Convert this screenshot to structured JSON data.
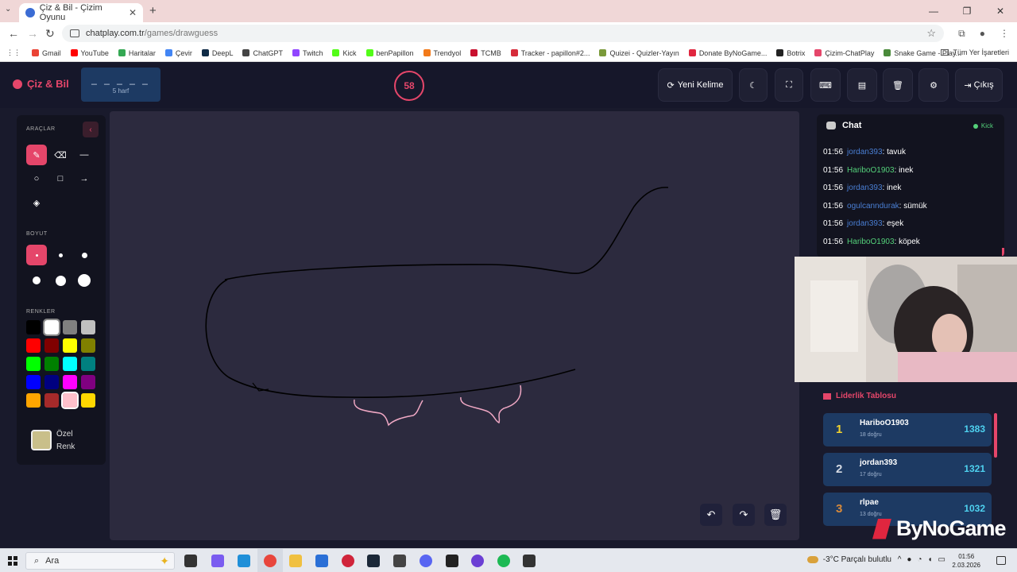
{
  "browser": {
    "tab_title": "Çiz & Bil - Çizim Oyunu",
    "url_domain": "chatplay.com.tr",
    "url_path": "/games/drawguess",
    "bookmarks": [
      {
        "label": "Gmail",
        "color": "#ea4335"
      },
      {
        "label": "YouTube",
        "color": "#ff0000"
      },
      {
        "label": "Haritalar",
        "color": "#34a853"
      },
      {
        "label": "Çevir",
        "color": "#4285f4"
      },
      {
        "label": "DeepL",
        "color": "#0f2b46"
      },
      {
        "label": "ChatGPT",
        "color": "#444444"
      },
      {
        "label": "Twitch",
        "color": "#9146ff"
      },
      {
        "label": "Kick",
        "color": "#53fc18"
      },
      {
        "label": "benPapillon",
        "color": "#53fc18"
      },
      {
        "label": "Trendyol",
        "color": "#f27a1a"
      },
      {
        "label": "TCMB",
        "color": "#c8102e"
      },
      {
        "label": "Tracker - papillon#2...",
        "color": "#d62b3a"
      },
      {
        "label": "Quizei - Quizler-Yayın",
        "color": "#7a9a3a"
      },
      {
        "label": "Donate ByNoGame...",
        "color": "#e0263f"
      },
      {
        "label": "Botrix",
        "color": "#222222"
      },
      {
        "label": "Çizim-ChatPlay",
        "color": "#e5466a"
      },
      {
        "label": "Snake Game - Play...",
        "color": "#4a8a3a"
      }
    ],
    "all_bookmarks": "Tüm Yer İşaretleri"
  },
  "app": {
    "logo": "Çiz & Bil",
    "word_blanks": "_ _ _ _ _",
    "word_hint": "5 harf",
    "timer": "58",
    "new_word": "Yeni Kelime",
    "exit": "Çıkış"
  },
  "tools": {
    "title": "ARAÇLAR",
    "size_title": "BOYUT",
    "colors_title": "RENKLER",
    "custom_color_line1": "Özel",
    "custom_color_line2": "Renk",
    "custom_color_value": "#c9bf8a",
    "palette": [
      "#000000",
      "#ffffff",
      "#808080",
      "#c0c0c0",
      "#ff0000",
      "#800000",
      "#ffff00",
      "#808000",
      "#00ff00",
      "#008000",
      "#00ffff",
      "#008080",
      "#0000ff",
      "#000080",
      "#ff00ff",
      "#800080",
      "#ffa500",
      "#a52a2a",
      "#ffc0cb",
      "#ffd700"
    ]
  },
  "chat": {
    "title": "Chat",
    "source": "Kick",
    "messages": [
      {
        "time": "01:56",
        "user": "jordan393",
        "user_color": "#4a7fd4",
        "text": "tavuk"
      },
      {
        "time": "01:56",
        "user": "HariboO1903",
        "user_color": "#54d17a",
        "text": "inek"
      },
      {
        "time": "01:56",
        "user": "jordan393",
        "user_color": "#4a7fd4",
        "text": "inek"
      },
      {
        "time": "01:56",
        "user": "ogulcanndurak",
        "user_color": "#4a7fd4",
        "text": "sümük"
      },
      {
        "time": "01:56",
        "user": "jordan393",
        "user_color": "#4a7fd4",
        "text": "eşek"
      },
      {
        "time": "01:56",
        "user": "HariboO1903",
        "user_color": "#54d17a",
        "text": "köpek"
      }
    ]
  },
  "leaderboard": {
    "title": "Liderlik Tablosu",
    "rows": [
      {
        "rank": "1",
        "rank_color": "#f2d22e",
        "name": "HariboO1903",
        "sub": "18 doğru",
        "score": "1383"
      },
      {
        "rank": "2",
        "rank_color": "#d6dbe4",
        "name": "jordan393",
        "sub": "17 doğru",
        "score": "1321"
      },
      {
        "rank": "3",
        "rank_color": "#d98a3a",
        "name": "rlpae",
        "sub": "13 doğru",
        "score": "1032"
      }
    ]
  },
  "watermark": "ByNoGame",
  "taskbar": {
    "search": "Ara",
    "weather": "-3°C  Parçalı bulutlu",
    "time": "01:56",
    "date": "2.03.2026"
  }
}
